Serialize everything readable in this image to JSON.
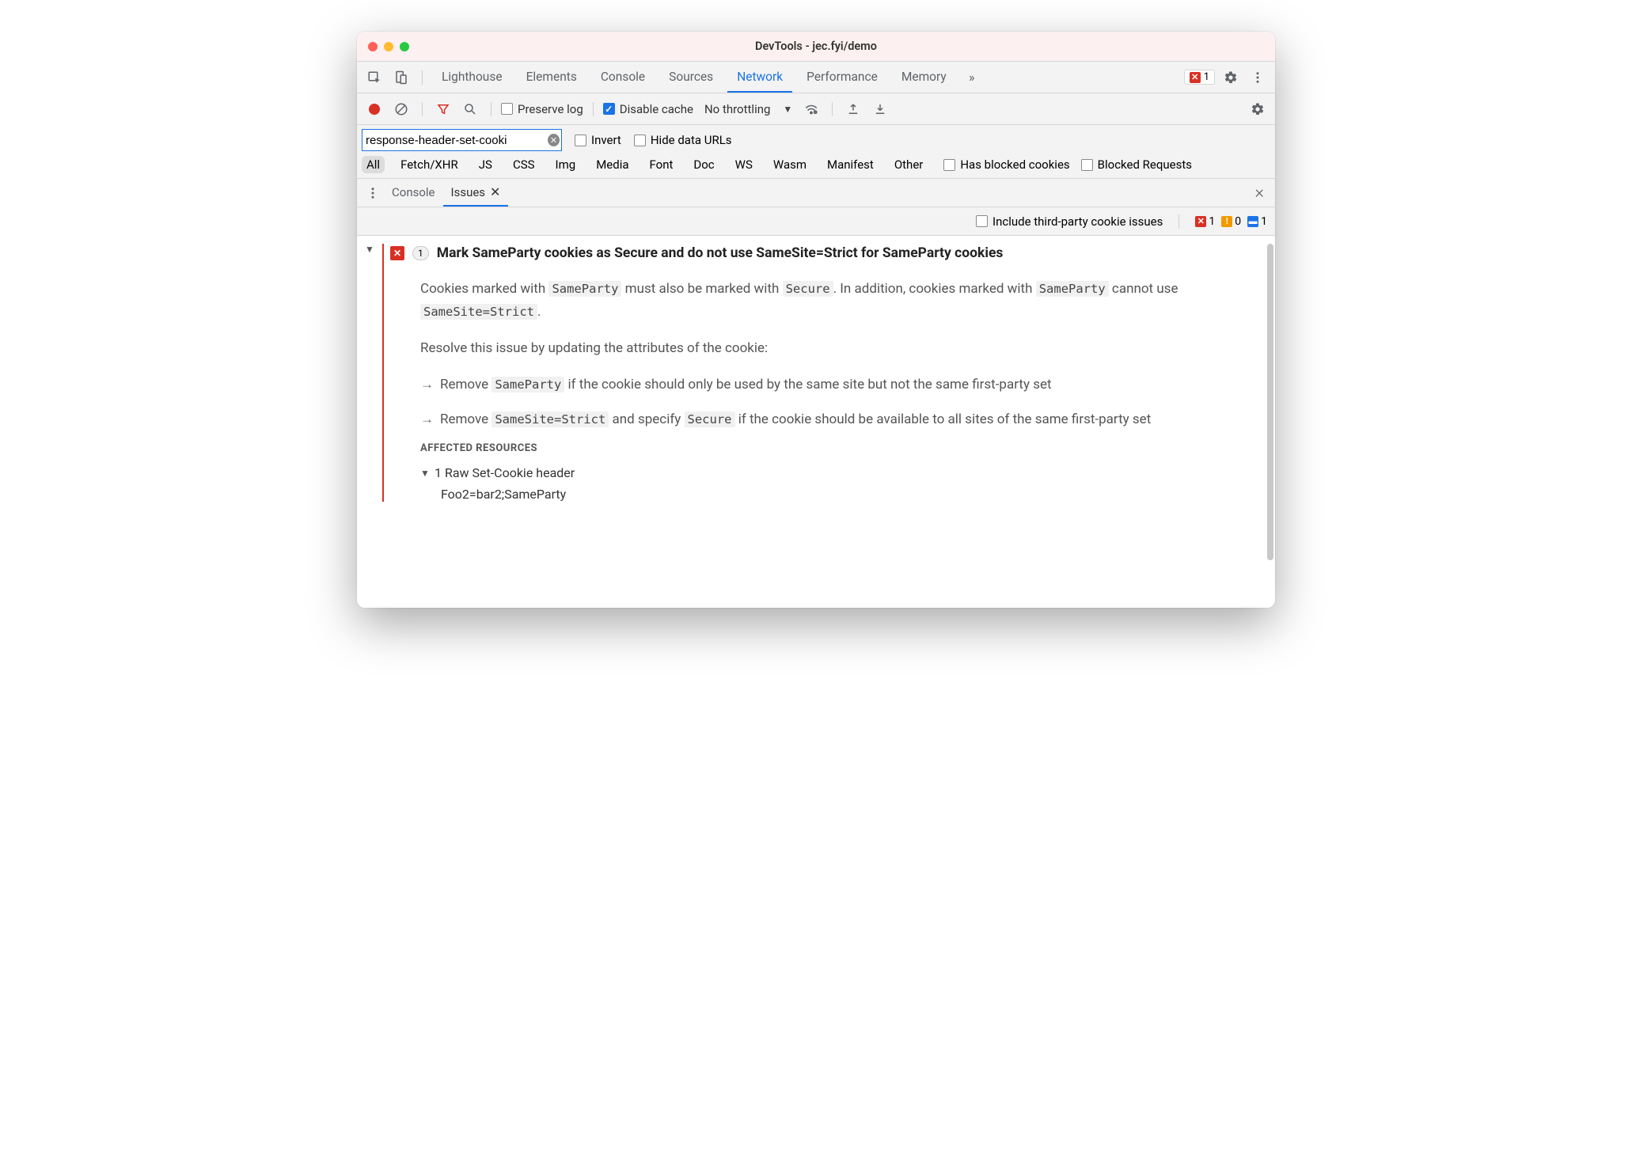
{
  "window": {
    "title": "DevTools - jec.fyi/demo"
  },
  "mainTabs": {
    "items": [
      "Lighthouse",
      "Elements",
      "Console",
      "Sources",
      "Network",
      "Performance",
      "Memory"
    ],
    "active": "Network",
    "overflow": "»",
    "errorBadge": "1"
  },
  "networkToolbar": {
    "preserveLog": "Preserve log",
    "disableCache": "Disable cache",
    "throttling": "No throttling"
  },
  "filter": {
    "value": "response-header-set-cooki",
    "invert": "Invert",
    "hideDataUrls": "Hide data URLs",
    "types": [
      "All",
      "Fetch/XHR",
      "JS",
      "CSS",
      "Img",
      "Media",
      "Font",
      "Doc",
      "WS",
      "Wasm",
      "Manifest",
      "Other"
    ],
    "typeActive": "All",
    "hasBlockedCookies": "Has blocked cookies",
    "blockedRequests": "Blocked Requests"
  },
  "drawer": {
    "tabs": [
      "Console",
      "Issues"
    ],
    "active": "Issues",
    "closeSymbol": "×"
  },
  "issuesToolbar": {
    "includeThirdParty": "Include third-party cookie issues",
    "counts": {
      "error": "1",
      "warning": "0",
      "info": "1"
    }
  },
  "issue": {
    "count": "1",
    "title": "Mark SameParty cookies as Secure and do not use SameSite=Strict for SameParty cookies",
    "para1_pre": "Cookies marked with ",
    "code1": "SameParty",
    "para1_mid": " must also be marked with ",
    "code2": "Secure",
    "para1_post": ". In addition, cookies marked with ",
    "code3": "SameParty",
    "para1_end1": " cannot use ",
    "code4": "SameSite=Strict",
    "para1_end2": ".",
    "para2": "Resolve this issue by updating the attributes of the cookie:",
    "b1_pre": "Remove ",
    "b1_code": "SameParty",
    "b1_post": " if the cookie should only be used by the same site but not the same first-party set",
    "b2_pre": "Remove ",
    "b2_code1": "SameSite=Strict",
    "b2_mid": " and specify ",
    "b2_code2": "Secure",
    "b2_post": " if the cookie should be available to all sites of the same first-party set",
    "affectedHeading": "AFFECTED RESOURCES",
    "affectedResourceTitle": "1 Raw Set-Cookie header",
    "affectedResourceValue": "Foo2=bar2;SameParty"
  }
}
